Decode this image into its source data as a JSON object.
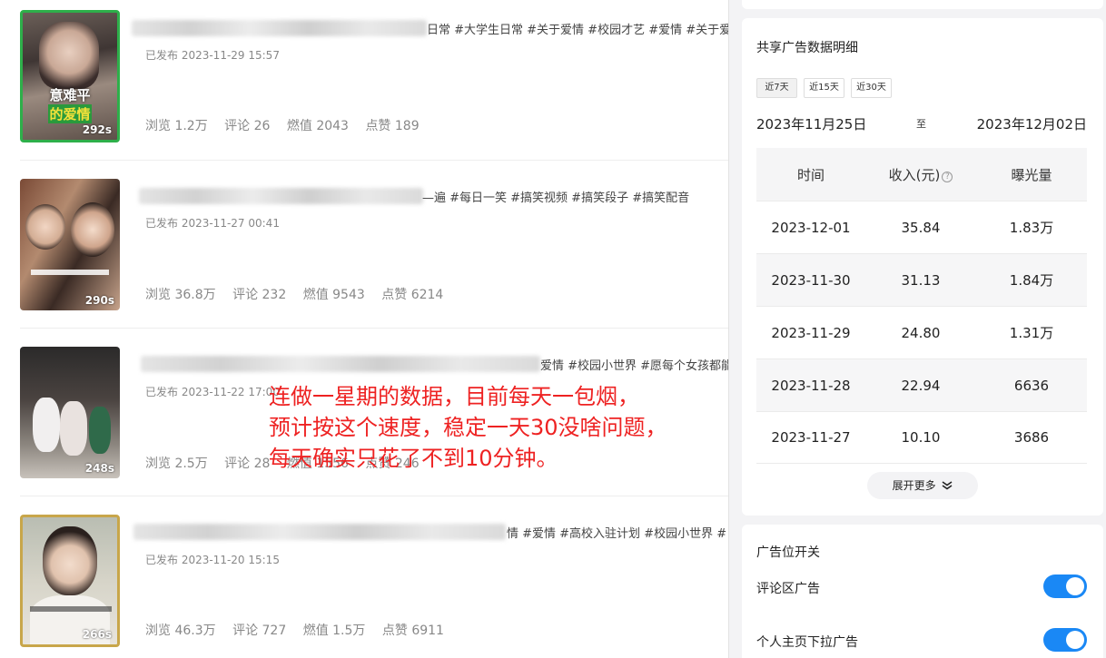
{
  "videos": [
    {
      "tags": "日常 #大学生日常 #关于爱情 #校园才艺 #爱情 #关于爱",
      "published": "已发布 2023-11-29 15:57",
      "duration": "292s",
      "thumb_caption_1": "意难平",
      "thumb_caption_2": "的爱情",
      "stats": {
        "views": "浏览 1.2万",
        "comments": "评论 26",
        "fuel": "燃值 2043",
        "likes": "点赞 189"
      }
    },
    {
      "tags": "—遍 #每日一笑 #搞笑视频 #搞笑段子 #搞笑配音",
      "published": "已发布 2023-11-27 00:41",
      "duration": "290s",
      "stats": {
        "views": "浏览 36.8万",
        "comments": "评论 232",
        "fuel": "燃值 9543",
        "likes": "点赞 6214"
      }
    },
    {
      "tags": "爱情 #校园小世界 #愿每个女孩都能",
      "published": "已发布 2023-11-22 17:00",
      "duration": "248s",
      "stats": {
        "views": "浏览 2.5万",
        "comments": "评论 28",
        "fuel": "燃值 1556",
        "likes": "点赞 246"
      }
    },
    {
      "tags": "情 #爱情 #高校入驻计划 #校园小世界 #",
      "published": "已发布 2023-11-20 15:15",
      "duration": "266s",
      "stats": {
        "views": "浏览 46.3万",
        "comments": "评论 727",
        "fuel": "燃值 1.5万",
        "likes": "点赞 6911"
      }
    }
  ],
  "overlay": {
    "line1": "连做一星期的数据，目前每天一包烟，",
    "line2": "预计按这个速度，稳定一天30没啥问题，",
    "line3": "每天确实只花了不到10分钟。"
  },
  "panel": {
    "title": "共享广告数据明细",
    "ranges": [
      "近7天",
      "近15天",
      "近30天"
    ],
    "start_date": "2023年11月25日",
    "date_sep": "至",
    "end_date": "2023年12月02日",
    "headers": {
      "time": "时间",
      "income": "收入(元)",
      "exposure": "曝光量"
    },
    "rows": [
      {
        "date": "2023-12-01",
        "income": "35.84",
        "exposure": "1.83万"
      },
      {
        "date": "2023-11-30",
        "income": "31.13",
        "exposure": "1.84万"
      },
      {
        "date": "2023-11-29",
        "income": "24.80",
        "exposure": "1.31万"
      },
      {
        "date": "2023-11-28",
        "income": "22.94",
        "exposure": "6636"
      },
      {
        "date": "2023-11-27",
        "income": "10.10",
        "exposure": "3686"
      }
    ],
    "more": "展开更多",
    "switch_title": "广告位开关",
    "switches": [
      {
        "label": "评论区广告",
        "on": true
      },
      {
        "label": "个人主页下拉广告",
        "on": true
      }
    ]
  },
  "colors": {
    "accent": "#1a88f5",
    "overlay": "#ee2222",
    "thumb_border_green": "#2eaf4a"
  },
  "icons": [
    "help-circle-icon",
    "chevron-double-down-icon"
  ]
}
